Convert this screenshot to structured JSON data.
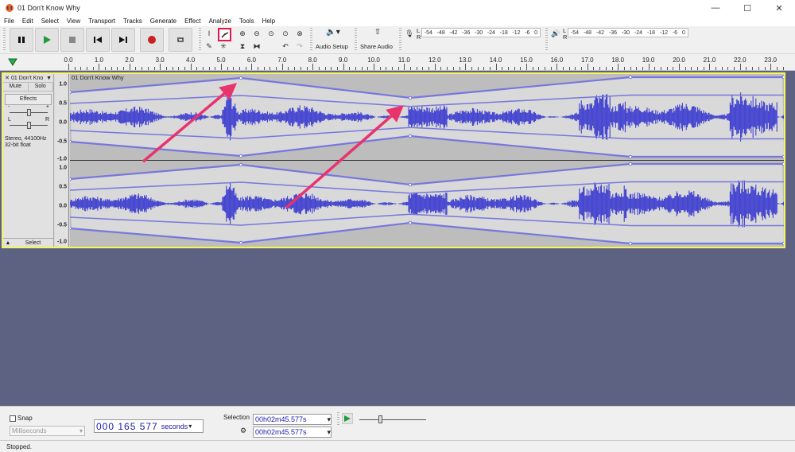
{
  "window": {
    "title": "01 Don't Know Why",
    "minimize": "—",
    "maximize": "☐",
    "close": "✕"
  },
  "menu": [
    "File",
    "Edit",
    "Select",
    "View",
    "Transport",
    "Tracks",
    "Generate",
    "Effect",
    "Analyze",
    "Tools",
    "Help"
  ],
  "toolbar": {
    "audio_setup_label": "Audio Setup",
    "share_audio_label": "Share Audio",
    "rec_meter_ticks": [
      "-54",
      "-48",
      "-42",
      "-36",
      "-30",
      "-24",
      "-18",
      "-12",
      "-6",
      "0"
    ],
    "play_meter_ticks": [
      "-54",
      "-48",
      "-42",
      "-36",
      "-30",
      "-24",
      "-18",
      "-12",
      "-6",
      "0"
    ],
    "meter_L": "L",
    "meter_R": "R"
  },
  "ruler": {
    "ticks": [
      "0.0",
      "1.0",
      "2.0",
      "3.0",
      "4.0",
      "5.0",
      "6.0",
      "7.0",
      "8.0",
      "9.0",
      "10.0",
      "11.0",
      "12.0",
      "13.0",
      "14.0",
      "15.0",
      "16.0",
      "17.0",
      "18.0",
      "19.0",
      "20.0",
      "21.0",
      "22.0",
      "23.0"
    ]
  },
  "track": {
    "name": "01 Don't Kno",
    "clip_name": "01 Don't Know Why",
    "mute": "Mute",
    "solo": "Solo",
    "effects": "Effects",
    "gain_minus": "-",
    "gain_plus": "+",
    "pan_L": "L",
    "pan_R": "R",
    "info_line1": "Stereo, 44100Hz",
    "info_line2": "32-bit float",
    "select": "Select",
    "scale_labels": [
      "1.0",
      "0.5",
      "0.0",
      "-0.5",
      "-1.0"
    ],
    "envelope_color": "#7777dd",
    "wave_color": "#3f3fd0"
  },
  "bottom": {
    "snap_label": "Snap",
    "snap_unit": "Milliseconds",
    "time_value": "000 165 577",
    "time_unit": "seconds",
    "selection_label": "Selection",
    "sel_start": "00h02m45.577s",
    "sel_end": "00h02m45.577s"
  },
  "status": {
    "text": "Stopped."
  },
  "colors": {
    "highlight_box": "#e8154c",
    "arrow": "#e8336c",
    "track_selected_border": "#f6f65a",
    "background": "#5d6283"
  }
}
